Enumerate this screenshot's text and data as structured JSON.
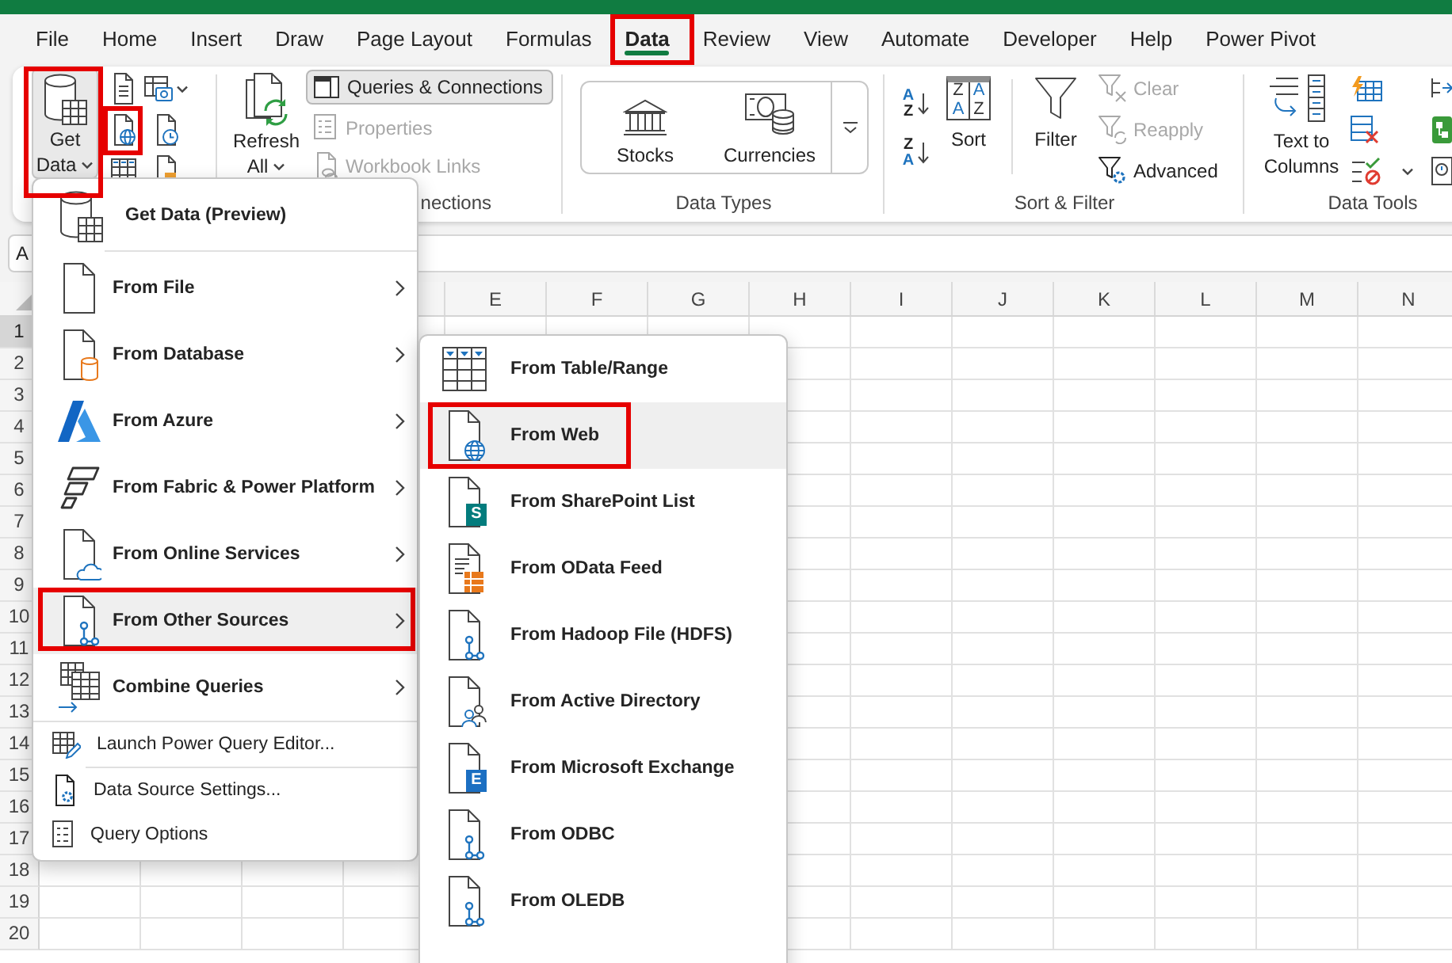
{
  "tabs": [
    {
      "label": "File",
      "selected": false,
      "highlighted": false
    },
    {
      "label": "Home",
      "selected": false,
      "highlighted": false
    },
    {
      "label": "Insert",
      "selected": false,
      "highlighted": false
    },
    {
      "label": "Draw",
      "selected": false,
      "highlighted": false
    },
    {
      "label": "Page Layout",
      "selected": false,
      "highlighted": false
    },
    {
      "label": "Formulas",
      "selected": false,
      "highlighted": false
    },
    {
      "label": "Data",
      "selected": true,
      "highlighted": true
    },
    {
      "label": "Review",
      "selected": false,
      "highlighted": false
    },
    {
      "label": "View",
      "selected": false,
      "highlighted": false
    },
    {
      "label": "Automate",
      "selected": false,
      "highlighted": false
    },
    {
      "label": "Developer",
      "selected": false,
      "highlighted": false
    },
    {
      "label": "Help",
      "selected": false,
      "highlighted": false
    },
    {
      "label": "Power Pivot",
      "selected": false,
      "highlighted": false
    }
  ],
  "ribbon": {
    "get_transform": {
      "get_data": {
        "label": "Get Data",
        "expanded": true,
        "highlighted": true
      },
      "web_button": {
        "highlighted": true
      }
    },
    "queries": {
      "refresh_all": {
        "label": "Refresh All"
      },
      "queries_connections": {
        "label": "Queries & Connections",
        "on": true
      },
      "properties": {
        "label": "Properties",
        "disabled": true
      },
      "workbook_links": {
        "label": "Workbook Links",
        "disabled": true
      },
      "group_label": "nections"
    },
    "data_types": {
      "stocks": {
        "label": "Stocks"
      },
      "currencies": {
        "label": "Currencies"
      },
      "group_label": "Data Types"
    },
    "sort_filter": {
      "sort_ascending": {
        "letters": [
          "A",
          "Z"
        ]
      },
      "sort_descending": {
        "letters": [
          "Z",
          "A"
        ]
      },
      "sort": {
        "label": "Sort",
        "letters": [
          "Z",
          "A",
          "A",
          "Z"
        ]
      },
      "filter": {
        "label": "Filter"
      },
      "clear": {
        "label": "Clear",
        "disabled": true
      },
      "reapply": {
        "label": "Reapply",
        "disabled": true
      },
      "advanced": {
        "label": "Advanced",
        "disabled": false
      },
      "group_label": "Sort & Filter"
    },
    "data_tools": {
      "text_to_columns": {
        "label": "Text to Columns"
      },
      "group_label": "Data Tools"
    }
  },
  "formula_bar": {
    "name_box": "A"
  },
  "sheet": {
    "columns": [
      "E",
      "F",
      "G",
      "H",
      "I",
      "J",
      "K",
      "L",
      "M",
      "N"
    ],
    "rows": [
      {
        "label": "1",
        "selected": true
      },
      {
        "label": "2",
        "selected": false
      },
      {
        "label": "3",
        "selected": false
      },
      {
        "label": "4",
        "selected": false
      },
      {
        "label": "5",
        "selected": false
      },
      {
        "label": "6",
        "selected": false
      },
      {
        "label": "7",
        "selected": false
      },
      {
        "label": "8",
        "selected": false
      },
      {
        "label": "9",
        "selected": false
      },
      {
        "label": "10",
        "selected": false
      },
      {
        "label": "11",
        "selected": false
      },
      {
        "label": "12",
        "selected": false
      },
      {
        "label": "13",
        "selected": false
      },
      {
        "label": "14",
        "selected": false
      },
      {
        "label": "15",
        "selected": false
      },
      {
        "label": "16",
        "selected": false
      },
      {
        "label": "17",
        "selected": false
      },
      {
        "label": "18",
        "selected": false
      },
      {
        "label": "19",
        "selected": false
      },
      {
        "label": "20",
        "selected": false
      }
    ]
  },
  "get_data_menu": {
    "items": [
      {
        "kind": "header",
        "label": "Get Data (Preview)",
        "selected": false,
        "highlighted": false
      },
      {
        "kind": "submenu",
        "label": "From File",
        "selected": false,
        "highlighted": false
      },
      {
        "kind": "submenu",
        "label": "From Database",
        "selected": false,
        "highlighted": false
      },
      {
        "kind": "submenu",
        "label": "From Azure",
        "selected": false,
        "highlighted": false
      },
      {
        "kind": "submenu",
        "label": "From Fabric & Power Platform",
        "selected": false,
        "highlighted": false
      },
      {
        "kind": "submenu",
        "label": "From Online Services",
        "selected": false,
        "highlighted": false
      },
      {
        "kind": "submenu",
        "label": "From Other Sources",
        "selected": true,
        "highlighted": true
      },
      {
        "kind": "submenu",
        "label": "Combine Queries",
        "selected": false,
        "highlighted": false
      },
      {
        "kind": "command",
        "label": "Launch Power Query Editor...",
        "selected": false,
        "highlighted": false
      },
      {
        "kind": "command",
        "label": "Data Source Settings...",
        "selected": false,
        "highlighted": false
      },
      {
        "kind": "command",
        "label": "Query Options",
        "selected": false,
        "highlighted": false
      }
    ]
  },
  "other_sources_menu": {
    "items": [
      {
        "label": "From Table/Range",
        "selected": false,
        "highlighted": false
      },
      {
        "label": "From Web",
        "selected": true,
        "highlighted": true
      },
      {
        "label": "From SharePoint List",
        "selected": false,
        "highlighted": false,
        "badge": {
          "text": "S",
          "color": "#037c7d"
        }
      },
      {
        "label": "From OData Feed",
        "selected": false,
        "highlighted": false
      },
      {
        "label": "From Hadoop File (HDFS)",
        "selected": false,
        "highlighted": false
      },
      {
        "label": "From Active Directory",
        "selected": false,
        "highlighted": false
      },
      {
        "label": "From Microsoft Exchange",
        "selected": false,
        "highlighted": false,
        "badge": {
          "text": "E",
          "color": "#1b6fc2"
        }
      },
      {
        "label": "From ODBC",
        "selected": false,
        "highlighted": false
      },
      {
        "label": "From OLEDB",
        "selected": false,
        "highlighted": false
      }
    ]
  }
}
